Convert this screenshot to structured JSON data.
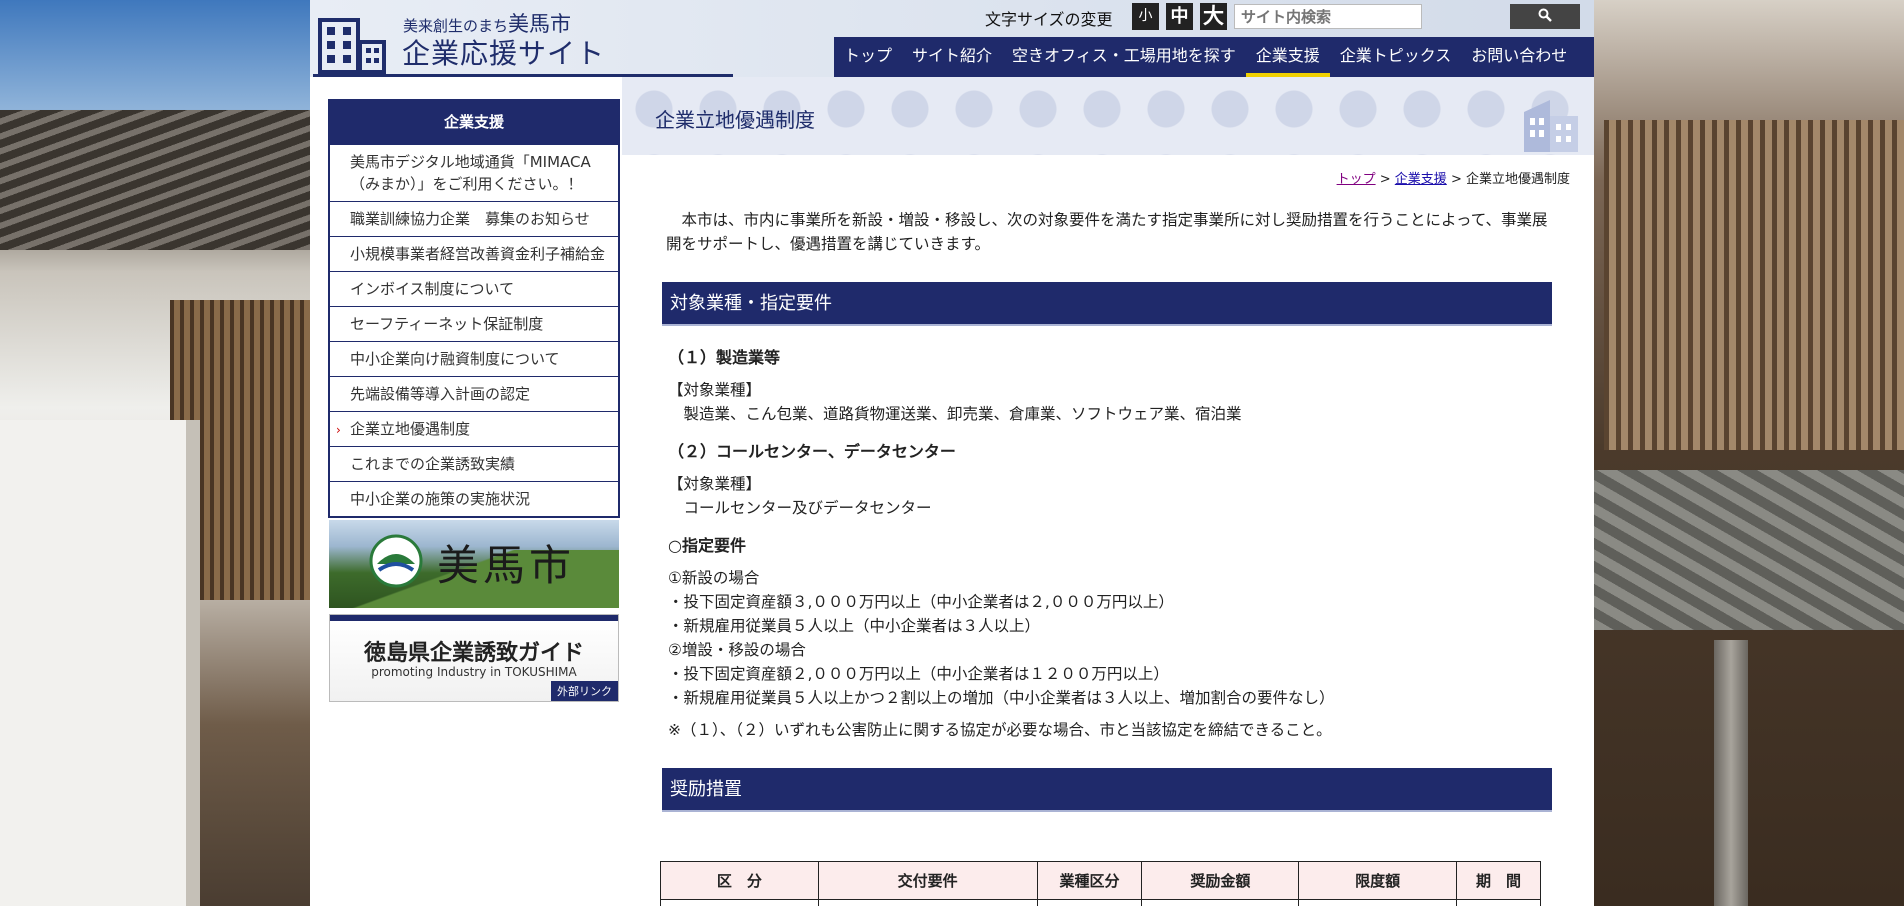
{
  "header": {
    "logo_sub_prefix": "美来創生のまち",
    "logo_sub_city": "美馬市",
    "logo_main": "企業応援サイト",
    "font_size_label": "文字サイズの変更",
    "font_size_small": "小",
    "font_size_medium": "中",
    "font_size_large": "大",
    "search_placeholder": "サイト内検索"
  },
  "nav": {
    "items": [
      {
        "label": "トップ"
      },
      {
        "label": "サイト紹介"
      },
      {
        "label": "空きオフィス・工場用地を探す"
      },
      {
        "label": "企業支援"
      },
      {
        "label": "企業トピックス"
      },
      {
        "label": "お問い合わせ"
      }
    ]
  },
  "sidebar": {
    "title": "企業支援",
    "items": [
      {
        "label": "美馬市デジタル地域通貨「MIMACA（みまか）」をご利用ください。！"
      },
      {
        "label": "職業訓練協力企業　募集のお知らせ"
      },
      {
        "label": "小規模事業者経営改善資金利子補給金"
      },
      {
        "label": "インボイス制度について"
      },
      {
        "label": "セーフティーネット保証制度"
      },
      {
        "label": "中小企業向け融資制度について"
      },
      {
        "label": "先端設備等導入計画の認定"
      },
      {
        "label": "企業立地優遇制度"
      },
      {
        "label": "これまでの企業誘致実績"
      },
      {
        "label": "中小企業の施策の実施状況"
      }
    ],
    "banner1_text": "美馬市",
    "banner2_title": "徳島県企業誘致ガイド",
    "banner2_sub": "promoting Industry in TOKUSHIMA",
    "banner2_ext": "外部リンク"
  },
  "main": {
    "page_title": "企業立地優遇制度",
    "breadcrumb": {
      "top": "トップ",
      "sep": ">",
      "section": "企業支援",
      "current": "企業立地優遇制度"
    },
    "intro": "　本市は、市内に事業所を新設・増設・移設し、次の対象要件を満たす指定事業所に対し奨励措置を行うことによって、事業展開をサポートし、優遇措置を講じていきます。",
    "section1_title": "対象業種・指定要件",
    "s1_h1": "（１）製造業等",
    "s1_label1": "【対象業種】",
    "s1_text1": "　製造業、こん包業、道路貨物運送業、卸売業、倉庫業、ソフトウェア業、宿泊業",
    "s1_h2": "（２）コールセンター、データセンター",
    "s1_label2": "【対象業種】",
    "s1_text2": "　コールセンター及びデータセンター",
    "s1_h3": "○指定要件",
    "req_lines": [
      "①新設の場合",
      "・投下固定資産額３,０００万円以上（中小企業者は２,０００万円以上）",
      "・新規雇用従業員５人以上（中小企業者は３人以上）",
      "②増設・移設の場合",
      "・投下固定資産額２,０００万円以上（中小企業者は１２００万円以上）",
      "・新規雇用従業員５人以上かつ２割以上の増加（中小企業者は３人以上、増加割合の要件なし）"
    ],
    "note": "※（１）、（２）いずれも公害防止に関する協定が必要な場合、市と当該協定を締結できること。",
    "section2_title": "奨励措置",
    "table_headers": [
      "区　分",
      "交付要件",
      "業種区分",
      "奨励金額",
      "限度額",
      "期　間"
    ]
  }
}
